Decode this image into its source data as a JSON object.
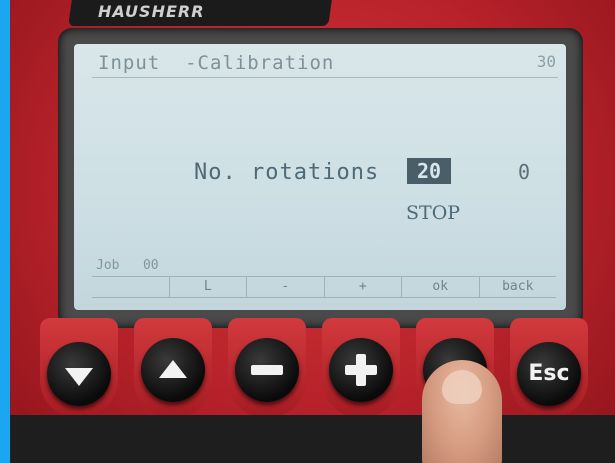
{
  "device": {
    "brand": "HAUSHERR"
  },
  "screen": {
    "title": "Input  -Calibration",
    "index": "30",
    "rotations_label": "No. rotations",
    "rotations_value": "20",
    "rotations_counter": "0",
    "status": "STOP",
    "job_label": "Job   00"
  },
  "softkeys": [
    "",
    "L",
    "-",
    "+",
    "ok",
    "back"
  ],
  "keys": [
    {
      "icon": "arrow-down-icon"
    },
    {
      "icon": "arrow-up-icon"
    },
    {
      "icon": "minus-icon"
    },
    {
      "icon": "plus-icon"
    },
    {
      "icon": "ok-blank-icon"
    },
    {
      "label": "Esc"
    }
  ],
  "colors": {
    "body_red": "#c02a30",
    "lcd": "#d2e2e6",
    "lcd_text": "#4e6a78",
    "key": "#111111",
    "background": "#1aa6f0"
  }
}
